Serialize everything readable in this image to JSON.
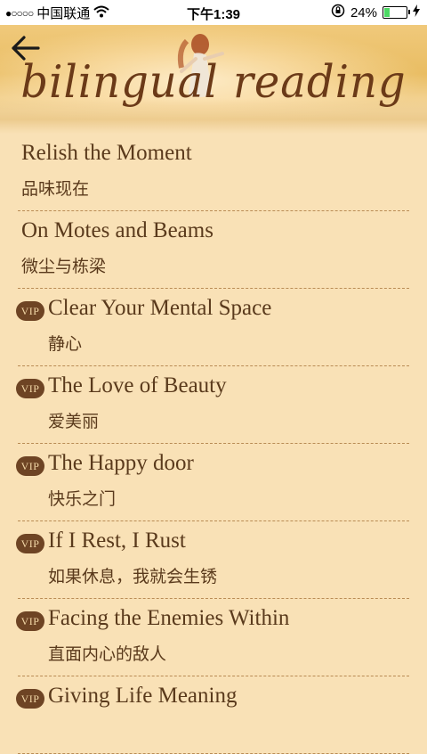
{
  "status_bar": {
    "signal_dots": "●○○○○",
    "carrier": "中国联通",
    "time": "下午1:39",
    "battery_percent": "24%",
    "battery_level": 0.24,
    "icons": [
      "wifi-icon",
      "rotation-lock-icon",
      "battery-icon",
      "charging-icon"
    ]
  },
  "header": {
    "back_icon": "back-arrow-icon",
    "banner_title": "bilingual reading"
  },
  "articles": [
    {
      "en": "Relish the Moment",
      "zh": "品味现在",
      "vip": false
    },
    {
      "en": "On Motes and Beams",
      "zh": "微尘与栋梁",
      "vip": false
    },
    {
      "en": "Clear Your Mental Space",
      "zh": "静心",
      "vip": true
    },
    {
      "en": "The Love of Beauty",
      "zh": "爱美丽",
      "vip": true
    },
    {
      "en": "The Happy door",
      "zh": "快乐之门",
      "vip": true
    },
    {
      "en": "If I Rest, I Rust",
      "zh": "如果休息，我就会生锈",
      "vip": true
    },
    {
      "en": "Facing the Enemies Within",
      "zh": "直面内心的敌人",
      "vip": true
    },
    {
      "en": "Giving Life Meaning",
      "zh": "",
      "vip": true
    }
  ],
  "vip_label": "VIP",
  "colors": {
    "background": "#f9e1b6",
    "text": "#5a3a1c",
    "vip_badge": "#6e4424",
    "divider": "#b98c55"
  }
}
